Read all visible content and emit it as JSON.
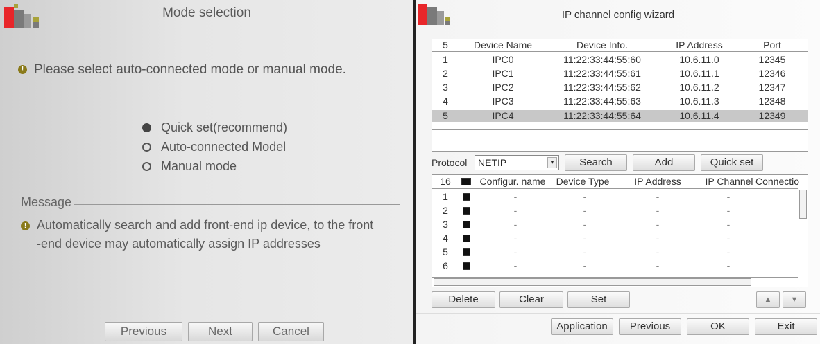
{
  "left": {
    "title": "Mode selection",
    "prompt": "Please select auto-connected mode or manual mode.",
    "modes": [
      {
        "label": "Quick set(recommend)",
        "selected": true
      },
      {
        "label": "Auto-connected Model",
        "selected": false
      },
      {
        "label": "Manual mode",
        "selected": false
      }
    ],
    "message_label": "Message",
    "message_line1": "Automatically search and add front-end ip device, to the front",
    "message_line2": "-end device may automatically assign IP addresses",
    "buttons": {
      "previous": "Previous",
      "next": "Next",
      "cancel": "Cancel"
    },
    "info_icon_glyph": "!"
  },
  "right": {
    "title": "IP channel config wizard",
    "device_table": {
      "count": "5",
      "columns": [
        "Device Name",
        "Device Info.",
        "IP Address",
        "Port"
      ],
      "rows": [
        {
          "num": "1",
          "name": "IPC0",
          "info": "11:22:33:44:55:60",
          "ip": "10.6.11.0",
          "port": "12345"
        },
        {
          "num": "2",
          "name": "IPC1",
          "info": "11:22:33:44:55:61",
          "ip": "10.6.11.1",
          "port": "12346"
        },
        {
          "num": "3",
          "name": "IPC2",
          "info": "11:22:33:44:55:62",
          "ip": "10.6.11.2",
          "port": "12347"
        },
        {
          "num": "4",
          "name": "IPC3",
          "info": "11:22:33:44:55:63",
          "ip": "10.6.11.3",
          "port": "12348"
        },
        {
          "num": "5",
          "name": "IPC4",
          "info": "11:22:33:44:55:64",
          "ip": "10.6.11.4",
          "port": "12349"
        }
      ],
      "selected_row": "5"
    },
    "protocol_label": "Protocol",
    "protocol_value": "NETIP",
    "search_button": "Search",
    "add_button": "Add",
    "quickset_button": "Quick set",
    "channel_table": {
      "count": "16",
      "columns": [
        "Configur. name",
        "Device Type",
        "IP Address",
        "IP Channel",
        "Connectio"
      ],
      "rows": [
        {
          "num": "1",
          "name": "-",
          "type": "-",
          "ip": "-",
          "chan": "-",
          "conn": "-"
        },
        {
          "num": "2",
          "name": "-",
          "type": "-",
          "ip": "-",
          "chan": "-",
          "conn": "-"
        },
        {
          "num": "3",
          "name": "-",
          "type": "-",
          "ip": "-",
          "chan": "-",
          "conn": "-"
        },
        {
          "num": "4",
          "name": "-",
          "type": "-",
          "ip": "-",
          "chan": "-",
          "conn": "-"
        },
        {
          "num": "5",
          "name": "-",
          "type": "-",
          "ip": "-",
          "chan": "-",
          "conn": "-"
        },
        {
          "num": "6",
          "name": "-",
          "type": "-",
          "ip": "-",
          "chan": "-",
          "conn": "-"
        }
      ]
    },
    "delete_button": "Delete",
    "clear_button": "Clear",
    "set_button": "Set",
    "application_button": "Application",
    "previous_button": "Previous",
    "ok_button": "OK",
    "exit_button": "Exit"
  },
  "colors": {
    "logo_red": "#e8262a",
    "logo_gray": "#7a7a7a",
    "logo_olive": "#a8a23a",
    "info_icon": "#8a7a1a",
    "selected_row": "#c8c8c8"
  }
}
